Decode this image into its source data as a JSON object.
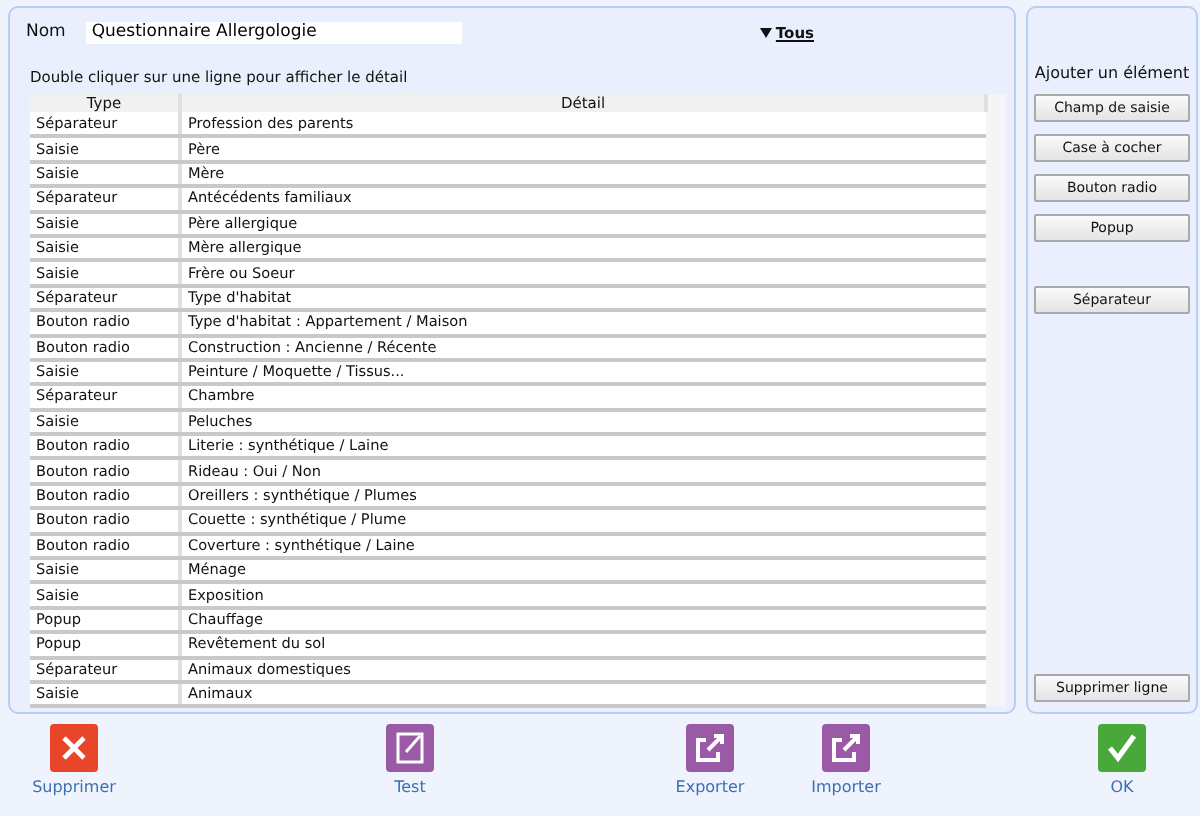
{
  "name_field": {
    "label": "Nom",
    "value": "Questionnaire Allergologie"
  },
  "filter": {
    "label": "Tous"
  },
  "hint": "Double cliquer sur une ligne pour afficher le détail",
  "table": {
    "columns": [
      "Type",
      "Détail"
    ],
    "rows": [
      [
        "Séparateur",
        "Profession des parents"
      ],
      [
        "Saisie",
        "Père"
      ],
      [
        "Saisie",
        "Mère"
      ],
      [
        "Séparateur",
        "Antécédents familiaux"
      ],
      [
        "Saisie",
        "Père allergique"
      ],
      [
        "Saisie",
        "Mère allergique"
      ],
      [
        "Saisie",
        "Frère ou Soeur"
      ],
      [
        "Séparateur",
        "Type d'habitat"
      ],
      [
        "Bouton radio",
        "Type d'habitat : Appartement / Maison"
      ],
      [
        "Bouton radio",
        "Construction : Ancienne / Récente"
      ],
      [
        "Saisie",
        "Peinture / Moquette / Tissus..."
      ],
      [
        "Séparateur",
        "Chambre"
      ],
      [
        "Saisie",
        "Peluches"
      ],
      [
        "Bouton radio",
        "Literie : synthétique / Laine"
      ],
      [
        "Bouton radio",
        "Rideau : Oui / Non"
      ],
      [
        "Bouton radio",
        "Oreillers : synthétique / Plumes"
      ],
      [
        "Bouton radio",
        "Couette : synthétique / Plume"
      ],
      [
        "Bouton radio",
        "Coverture : synthétique / Laine"
      ],
      [
        "Saisie",
        "Ménage"
      ],
      [
        "Saisie",
        "Exposition"
      ],
      [
        "Popup",
        "Chauffage"
      ],
      [
        "Popup",
        "Revêtement du sol"
      ],
      [
        "Séparateur",
        "Animaux domestiques"
      ],
      [
        "Saisie",
        "Animaux"
      ]
    ]
  },
  "add_panel": {
    "title": "Ajouter un élément",
    "button_groups": [
      [
        "Champ de saisie",
        "Case à cocher",
        "Bouton radio",
        "Popup"
      ],
      [
        "Séparateur"
      ]
    ],
    "delete_button": "Supprimer ligne"
  },
  "actions": [
    {
      "kind": "delete",
      "label": "Supprimer"
    },
    {
      "kind": "edit",
      "label": "Test"
    },
    {
      "kind": "export",
      "label": "Exporter"
    },
    {
      "kind": "export",
      "label": "Importer"
    },
    {
      "kind": "ok",
      "label": "OK"
    }
  ]
}
